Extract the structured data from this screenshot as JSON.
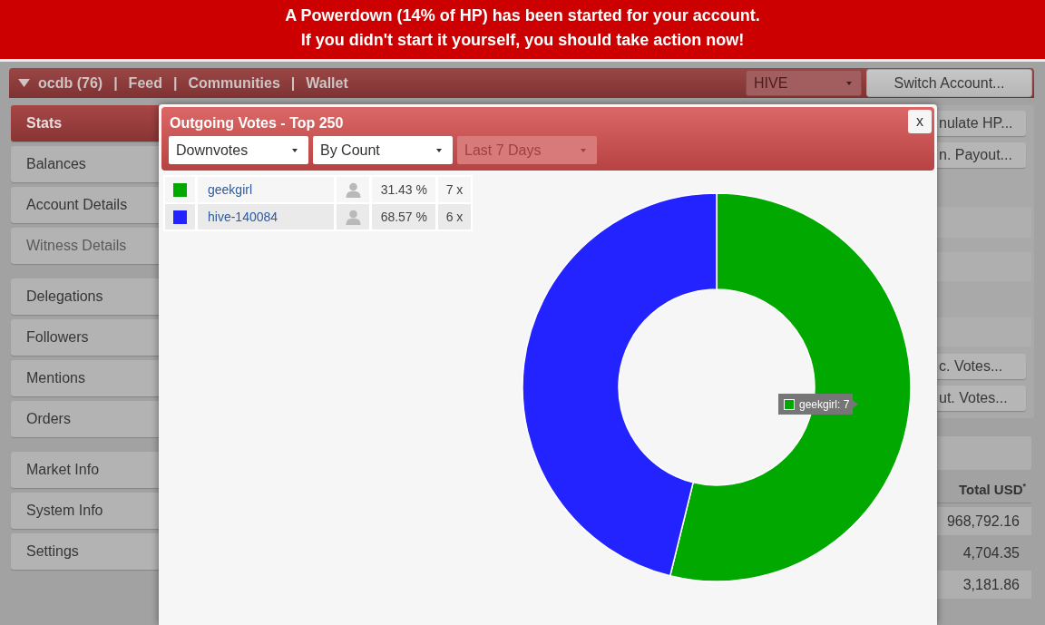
{
  "banner": {
    "lines": [
      "A Powerdown (14% of HP) has been started for your account.",
      "If you didn't start it yourself, you should take action now!"
    ]
  },
  "nav": {
    "items": [
      {
        "kind": "account",
        "label": "ocdb (76)"
      },
      {
        "kind": "separator",
        "label": "|"
      },
      {
        "kind": "link",
        "label": "Feed"
      },
      {
        "kind": "separator",
        "label": "|"
      },
      {
        "kind": "link",
        "label": "Communities"
      },
      {
        "kind": "separator",
        "label": "|"
      },
      {
        "kind": "link",
        "label": "Wallet"
      }
    ],
    "currency_select": {
      "value": "HIVE",
      "disabled": true
    },
    "switch_button": "Switch Account..."
  },
  "sidebar": {
    "groups": [
      {
        "items": [
          {
            "label": "Stats",
            "selected": true,
            "disabled": false
          },
          {
            "label": "Balances",
            "selected": false,
            "disabled": false
          },
          {
            "label": "Account Details",
            "selected": false,
            "disabled": false
          },
          {
            "label": "Witness Details",
            "selected": false,
            "disabled": true
          }
        ]
      },
      {
        "items": [
          {
            "label": "Delegations",
            "selected": false,
            "disabled": false
          },
          {
            "label": "Followers",
            "selected": false,
            "disabled": false
          },
          {
            "label": "Mentions",
            "selected": false,
            "disabled": false
          },
          {
            "label": "Orders",
            "selected": false,
            "disabled": false
          }
        ]
      },
      {
        "items": [
          {
            "label": "Market Info",
            "selected": false,
            "disabled": false
          },
          {
            "label": "System Info",
            "selected": false,
            "disabled": false
          },
          {
            "label": "Settings",
            "selected": false,
            "disabled": false
          }
        ]
      }
    ]
  },
  "background_panel": {
    "buttons_top": [
      "nulate HP...",
      "n. Payout..."
    ],
    "buttons_bottom": [
      "c. Votes...",
      "ut. Votes..."
    ],
    "table": {
      "header": "Total USD$^{*}$",
      "rows": [
        "968,792.16",
        "4,704.35",
        "3,181.86"
      ]
    }
  },
  "votes_modal": {
    "title": "Outgoing Votes - Top 250",
    "close": "x",
    "filters": [
      {
        "value": "Downvotes",
        "disabled": false
      },
      {
        "value": "By Count",
        "disabled": false
      },
      {
        "value": "Last 7 Days",
        "disabled": true
      }
    ],
    "legend": [
      {
        "color": "#00a800",
        "percent": "31.43 %",
        "count": "7 x"
      },
      {
        "color": "#2323ff",
        "percent": "68.57 %",
        "count": "6 x"
      }
    ],
    "chart_data": {
      "type": "donut",
      "categories": [
        "geekgirl",
        "hive-140084"
      ],
      "values": [
        53.85,
        46.15
      ]
    },
    "tooltip": {
      "label": "geekgirl: 7",
      "color": "#00a800"
    }
  }
}
